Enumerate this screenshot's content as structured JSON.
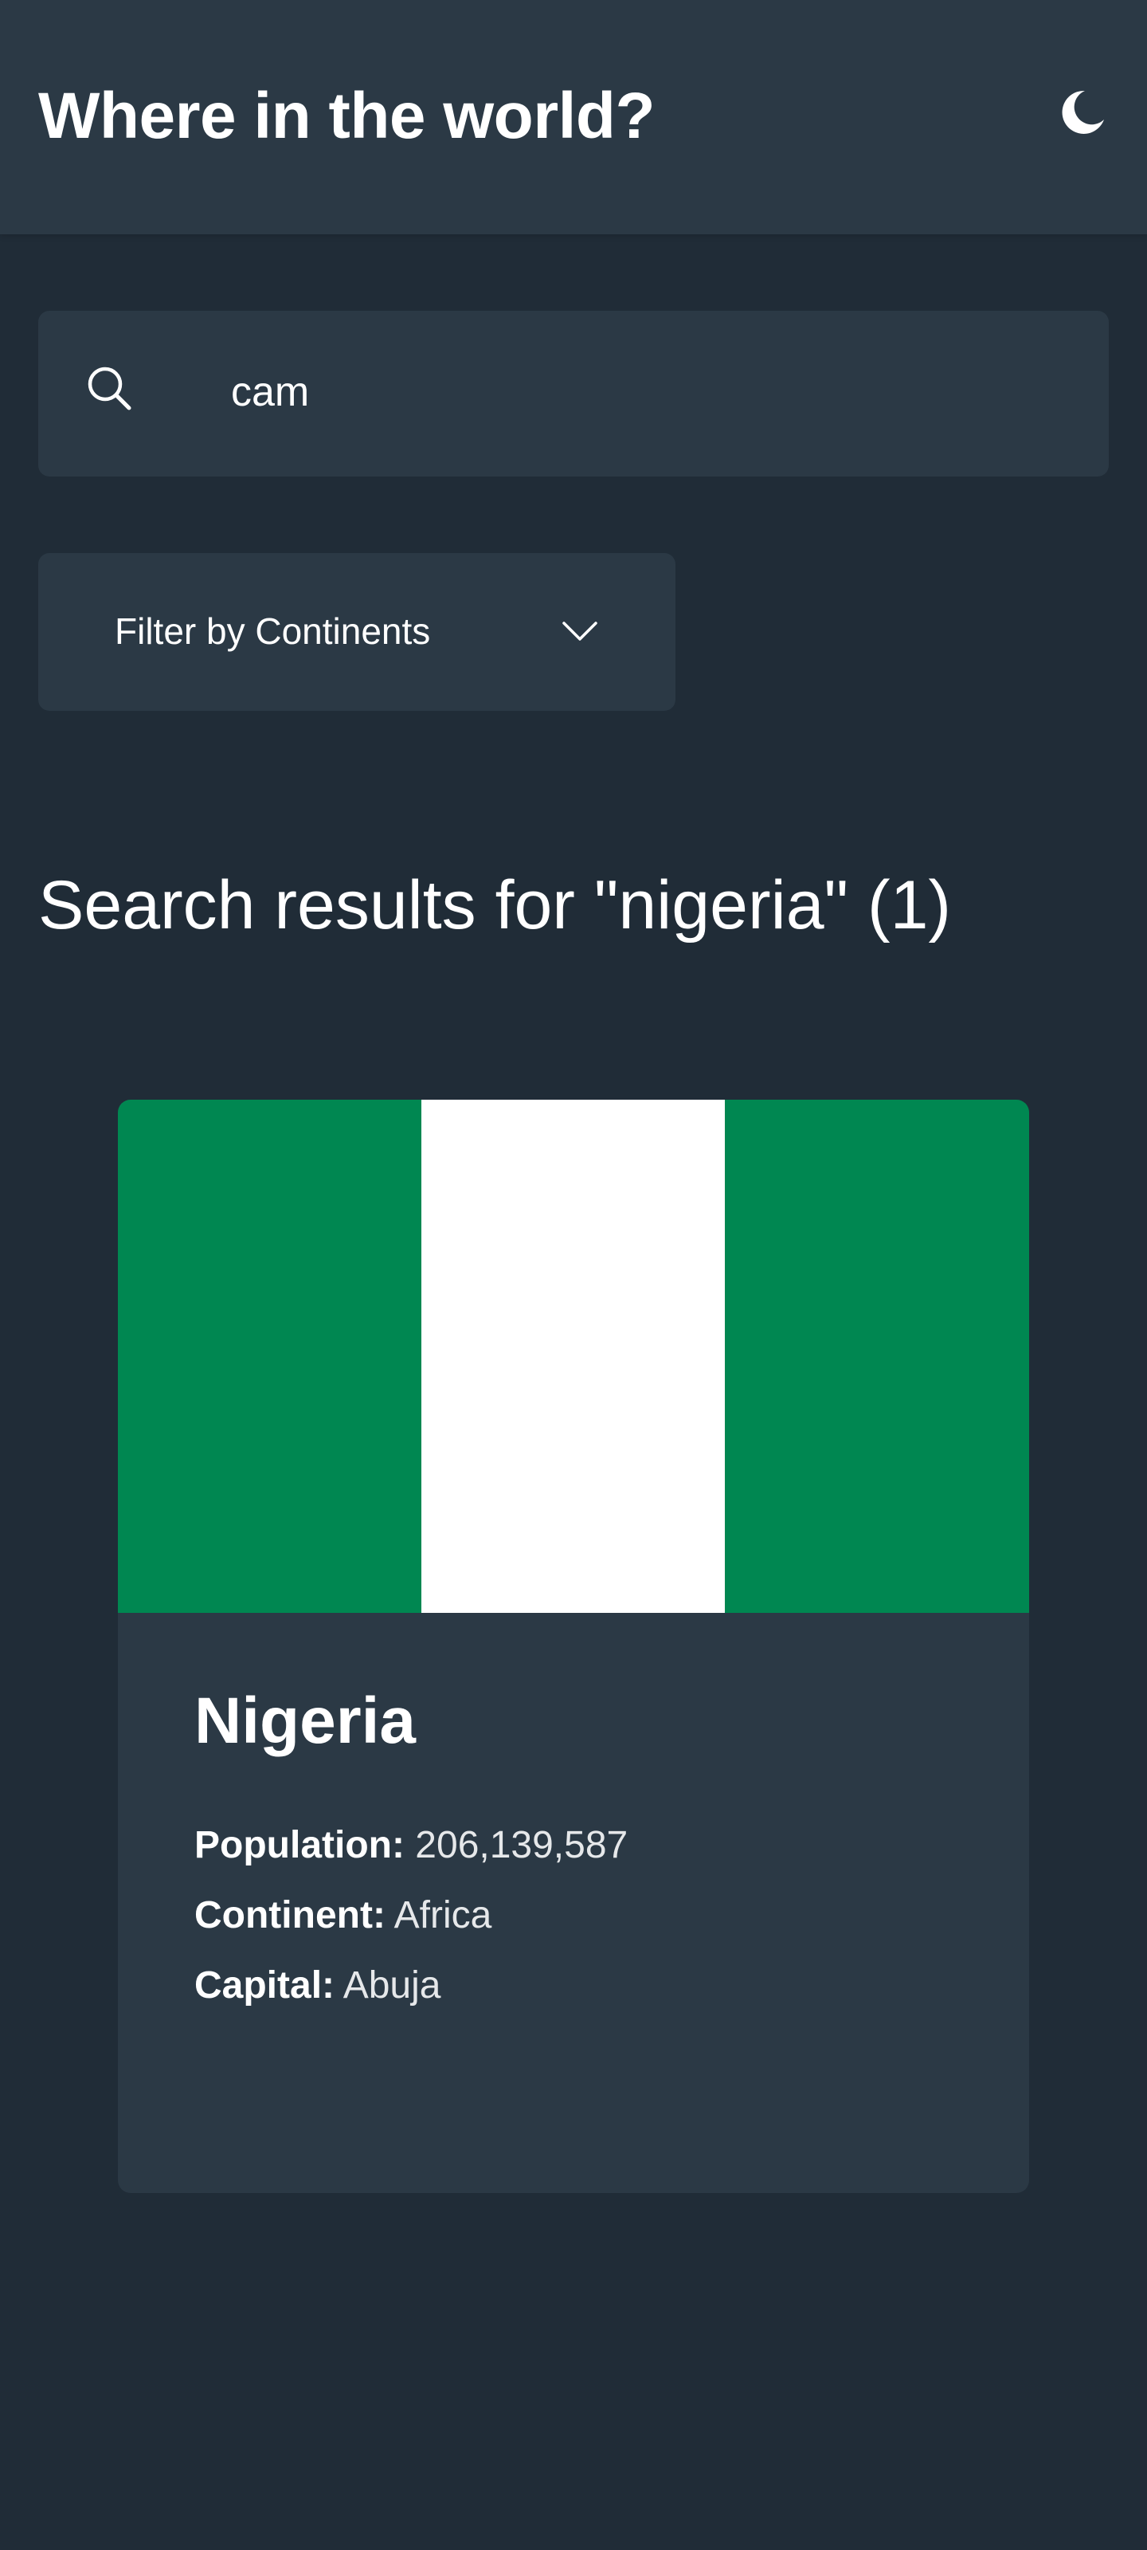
{
  "header": {
    "title": "Where in the world?",
    "theme_toggle_icon": "moon-icon"
  },
  "search": {
    "icon": "search-icon",
    "value": "cam",
    "placeholder": ""
  },
  "filter": {
    "label": "Filter by Continents",
    "icon": "chevron-down-icon"
  },
  "results": {
    "heading": "Search results for \"nigeria\" (1)"
  },
  "countries": [
    {
      "name": "Nigeria",
      "flag_colors": [
        "#008751",
        "#ffffff",
        "#008751"
      ],
      "population_label": "Population:",
      "population": "206,139,587",
      "continent_label": "Continent:",
      "continent": "Africa",
      "capital_label": "Capital:",
      "capital": "Abuja"
    }
  ],
  "colors": {
    "background": "#202c37",
    "elements": "#2b3945",
    "text": "#ffffff"
  }
}
